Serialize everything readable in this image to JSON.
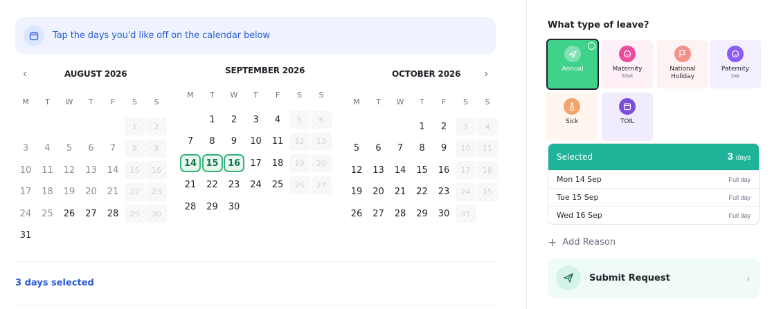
{
  "banner": {
    "text": "Tap the days you'd like off on the calendar below",
    "icon": "calendar-icon"
  },
  "nav": {
    "prev": "‹",
    "next": "›"
  },
  "weekdays": [
    "M",
    "T",
    "W",
    "T",
    "F",
    "S",
    "S"
  ],
  "months": [
    {
      "title": "AUGUST 2026",
      "rows": [
        [
          null,
          null,
          null,
          null,
          null,
          1,
          2
        ],
        [
          3,
          4,
          5,
          6,
          7,
          8,
          9
        ],
        [
          10,
          11,
          12,
          13,
          14,
          15,
          16
        ],
        [
          17,
          18,
          19,
          20,
          21,
          22,
          23
        ],
        [
          24,
          25,
          26,
          27,
          28,
          29,
          30
        ],
        [
          31,
          null,
          null,
          null,
          null,
          null,
          null
        ]
      ],
      "past_before": 26
    },
    {
      "title": "SEPTEMBER 2026",
      "rows": [
        [
          null,
          1,
          2,
          3,
          4,
          5,
          6
        ],
        [
          7,
          8,
          9,
          10,
          11,
          12,
          13
        ],
        [
          14,
          15,
          16,
          17,
          18,
          19,
          20
        ],
        [
          21,
          22,
          23,
          24,
          25,
          26,
          27
        ],
        [
          28,
          29,
          30,
          null,
          null,
          null,
          null
        ]
      ],
      "selected": [
        14,
        15,
        16
      ]
    },
    {
      "title": "OCTOBER 2026",
      "rows": [
        [
          null,
          null,
          null,
          1,
          2,
          3,
          4
        ],
        [
          5,
          6,
          7,
          8,
          9,
          10,
          11
        ],
        [
          12,
          13,
          14,
          15,
          16,
          17,
          18
        ],
        [
          19,
          20,
          21,
          22,
          23,
          24,
          25
        ],
        [
          26,
          27,
          28,
          29,
          30,
          31,
          null
        ]
      ]
    }
  ],
  "footer": {
    "days_selected": "3 days selected"
  },
  "leave": {
    "title": "What type of leave?",
    "types": [
      {
        "label": "Annual",
        "sub": "",
        "icon": "plane-icon",
        "color": "#3ed28a",
        "bg": "#3ed28a",
        "selected": true
      },
      {
        "label": "Maternity",
        "sub": "52wk",
        "icon": "baby-icon",
        "color": "#ec4c9c",
        "bg": "#fdf0f6",
        "selected": false
      },
      {
        "label": "National Holiday",
        "sub": "",
        "icon": "flag-icon",
        "color": "#f4918a",
        "bg": "#fdf3f2",
        "selected": false
      },
      {
        "label": "Paternity",
        "sub": "2wk",
        "icon": "baby-icon",
        "color": "#8b5cf6",
        "bg": "#f3efff",
        "selected": false
      },
      {
        "label": "Sick",
        "sub": "",
        "icon": "thermometer-icon",
        "color": "#f4a46a",
        "bg": "#fef6ef",
        "selected": false
      },
      {
        "label": "TOIL",
        "sub": "",
        "icon": "calendar-icon",
        "color": "#7c4ddb",
        "bg": "#f1ecfd",
        "selected": false
      }
    ]
  },
  "selected": {
    "title": "Selected",
    "count": "3",
    "unit": "days",
    "rows": [
      {
        "date": "Mon 14 Sep",
        "type": "Full day"
      },
      {
        "date": "Tue 15 Sep",
        "type": "Full day"
      },
      {
        "date": "Wed 16 Sep",
        "type": "Full day"
      }
    ]
  },
  "add_reason": "Add Reason",
  "submit": {
    "label": "Submit Request"
  },
  "colors": {
    "accent": "#1fb39a",
    "link": "#2a5bd7",
    "selected_day": "#34b278"
  }
}
